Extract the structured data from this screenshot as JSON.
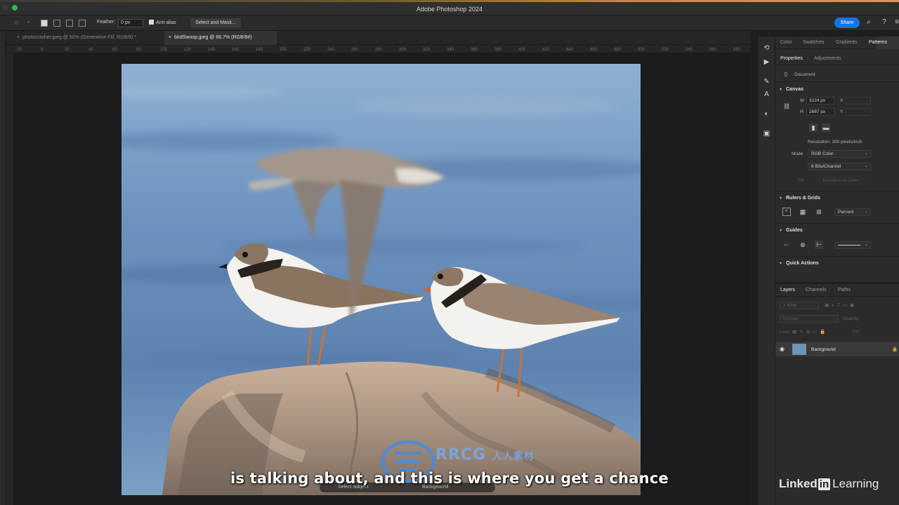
{
  "app": {
    "title": "Adobe Photoshop 2024"
  },
  "topbar": {
    "share_label": "Share",
    "icons": [
      "search-icon",
      "help-icon",
      "menu-icon"
    ]
  },
  "options": {
    "feather_label": "Feather:",
    "feather_value": "0 px",
    "antialias_label": "Anti-alias",
    "select_mask_label": "Select and Mask..."
  },
  "tabs": [
    {
      "label": "photocrasher.jpeg @ 50% (Generative Fill, RGB/8) *",
      "active": false
    },
    {
      "label": "birdSwoop.jpeg @ 66.7% (RGB/8#)",
      "active": true
    }
  ],
  "ruler_ticks": [
    "20",
    "0",
    "20",
    "40",
    "60",
    "80",
    "100",
    "120",
    "140",
    "160",
    "180",
    "200",
    "220",
    "240",
    "260",
    "280",
    "300",
    "320",
    "340",
    "360",
    "380",
    "400",
    "420",
    "440",
    "460",
    "480",
    "500",
    "520",
    "540",
    "560",
    "580"
  ],
  "panels": {
    "top_tabs": [
      "Color",
      "Swatches",
      "Gradients",
      "Patterns"
    ],
    "sub_tabs": [
      "Properties",
      "Adjustments"
    ],
    "document_label": "Document",
    "canvas": {
      "title": "Canvas",
      "w_label": "W",
      "w_value": "3224 px",
      "x_label": "X",
      "h_label": "H",
      "h_value": "2687 px",
      "y_label": "Y",
      "resolution": "Resolution: 300 pixels/inch",
      "mode_label": "Mode",
      "mode_value": "RGB Color",
      "bits_value": "8 Bits/Channel",
      "fill_label": "Fill",
      "fill_value": "Background Color"
    },
    "rulers": {
      "title": "Rulers & Grids",
      "unit_value": "Percent"
    },
    "guides": {
      "title": "Guides"
    },
    "quick_actions": {
      "title": "Quick Actions"
    },
    "layers": {
      "tabs": [
        "Layers",
        "Channels",
        "Paths"
      ],
      "kind_label": "Kind",
      "blend_value": "Normal",
      "opacity_label": "Opacity:",
      "lock_label": "Lock:",
      "fill_label": "Fill:",
      "layer_name": "Background"
    }
  },
  "bottom_bar": {
    "select_subject": "Select subject",
    "background": "Background"
  },
  "caption": "is talking about, and this is where you get a chance",
  "watermark": {
    "text": "RRCG",
    "subtitle": "人人素材"
  },
  "brand": {
    "name_left": "Linked",
    "name_in": "in",
    "name_right": "Learning"
  },
  "colors": {
    "accent": "#1473e6",
    "panel_bg": "#2b2b2b",
    "workspace_bg": "#1c1c1c"
  }
}
